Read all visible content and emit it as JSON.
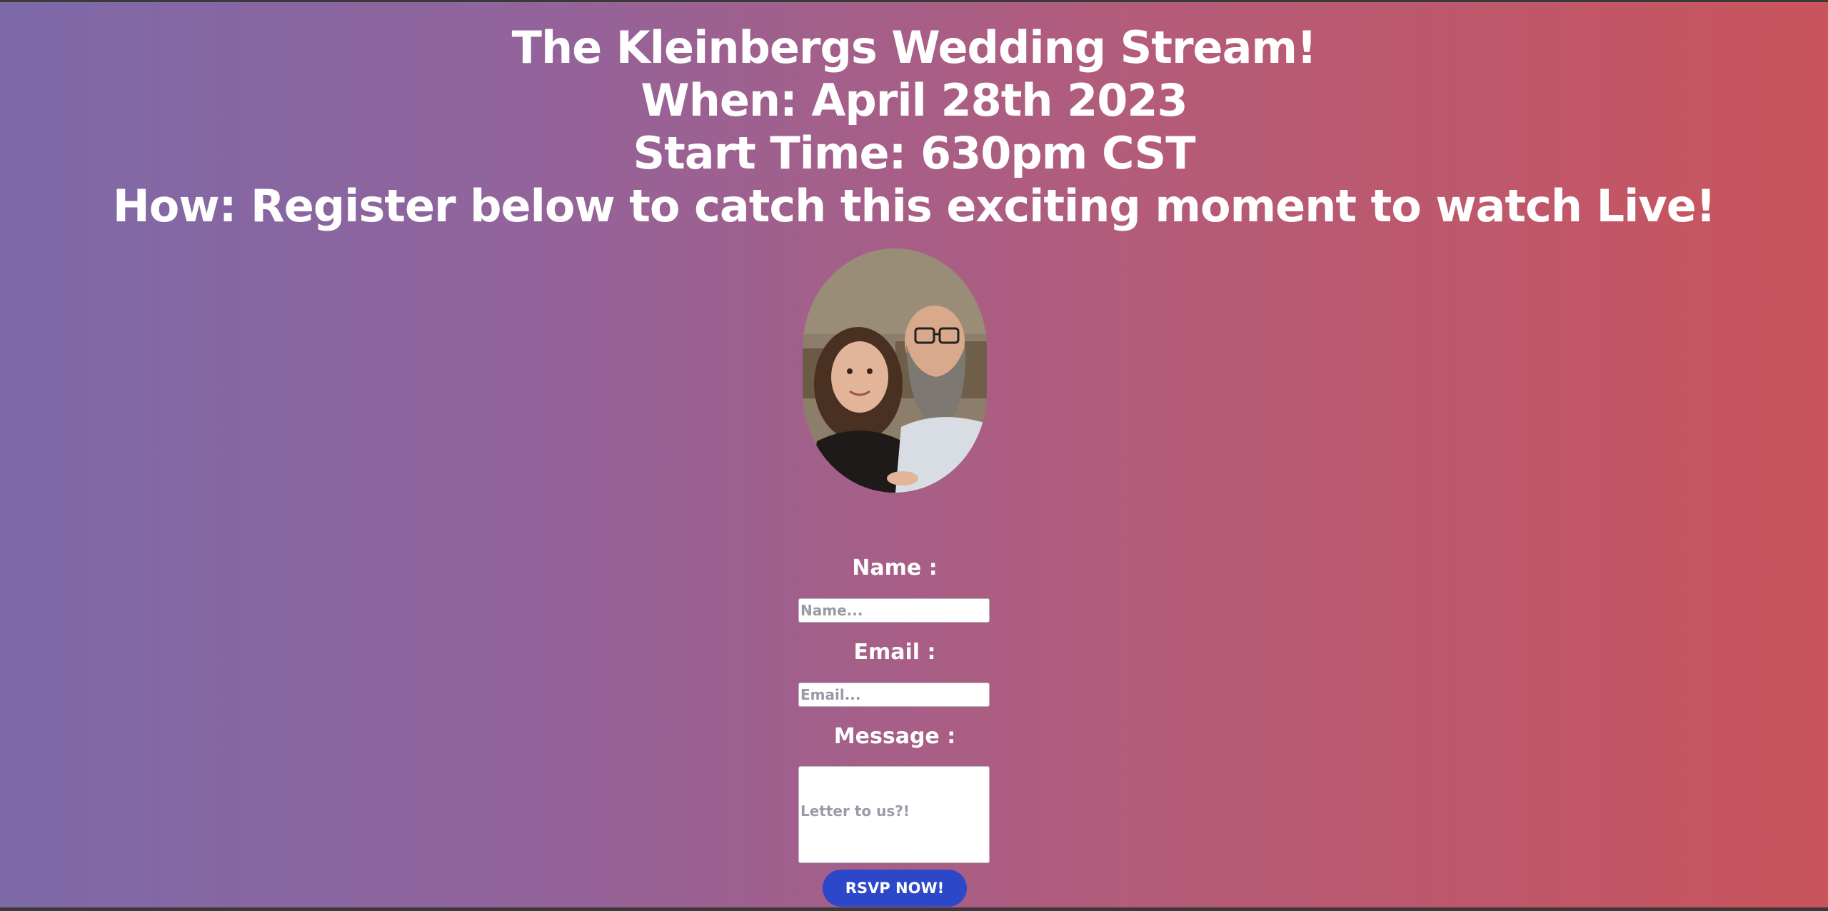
{
  "header": {
    "title": "The Kleinbergs Wedding Stream!",
    "when": "When: April 28th 2023",
    "start_time": "Start Time: 630pm CST",
    "how": "How: Register below to catch this exciting moment to watch Live!"
  },
  "photo": {
    "icon": "couple-photo"
  },
  "form": {
    "name_label": "Name :",
    "name_placeholder": "Name...",
    "email_label": "Email :",
    "email_placeholder": "Email...",
    "message_label": "Message :",
    "message_placeholder": "Letter to us?!",
    "submit_label": "RSVP NOW!"
  },
  "colors": {
    "gradient_start": "#7d69a8",
    "gradient_end": "#c9545c",
    "button": "#2c47c8",
    "text": "#ffffff"
  }
}
